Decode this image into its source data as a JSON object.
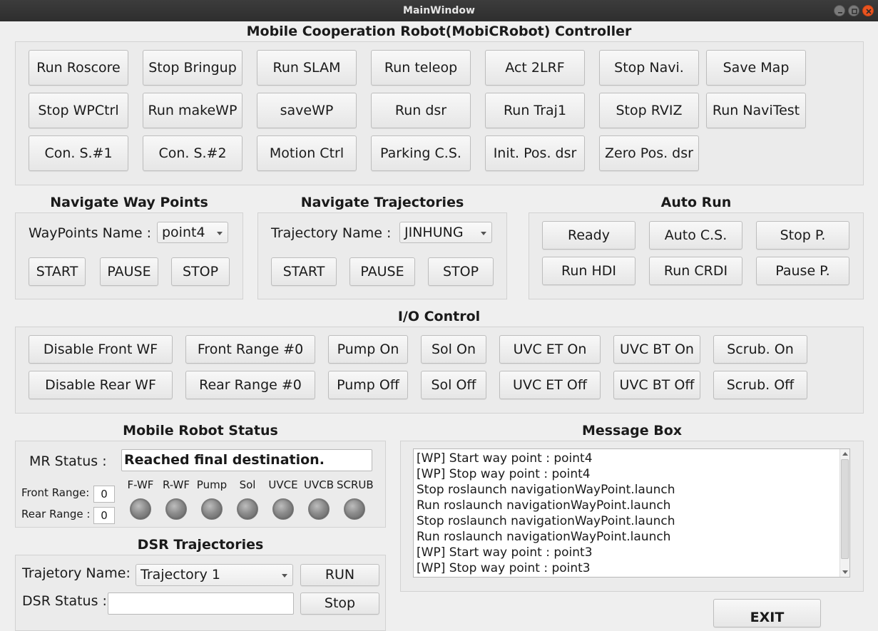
{
  "window": {
    "title": "MainWindow"
  },
  "controller": {
    "title": "Mobile Cooperation Robot(MobiCRobot) Controller",
    "buttons": [
      "Run Roscore",
      "Stop Bringup",
      "Run SLAM",
      "Run teleop",
      "Act 2LRF",
      "Stop Navi.",
      "Save Map",
      "Stop WPCtrl",
      "Run makeWP",
      "saveWP",
      "Run dsr",
      "Run Traj1",
      "Stop RVIZ",
      "Run NaviTest",
      "Con. S.#1",
      "Con. S.#2",
      "Motion Ctrl",
      "Parking C.S.",
      "Init. Pos. dsr",
      "Zero Pos. dsr"
    ]
  },
  "waypoints": {
    "title": "Navigate Way Points",
    "name_label": "WayPoints Name :",
    "selected": "point4",
    "start": "START",
    "pause": "PAUSE",
    "stop": "STOP"
  },
  "trajectories": {
    "title": "Navigate Trajectories",
    "name_label": "Trajectory Name :",
    "selected": "JINHUNG",
    "start": "START",
    "pause": "PAUSE",
    "stop": "STOP"
  },
  "autorun": {
    "title": "Auto Run",
    "buttons": [
      "Ready",
      "Auto C.S.",
      "Stop P.",
      "Run HDI",
      "Run CRDI",
      "Pause P."
    ]
  },
  "io": {
    "title": "I/O Control",
    "buttons": [
      "Disable Front WF",
      "Front Range #0",
      "Pump On",
      "Sol On",
      "UVC ET On",
      "UVC BT On",
      "Scrub. On",
      "Disable Rear WF",
      "Rear Range #0",
      "Pump Off",
      "Sol Off",
      "UVC ET Off",
      "UVC BT Off",
      "Scrub. Off"
    ]
  },
  "status": {
    "title": "Mobile Robot Status",
    "mr_label": "MR Status   :",
    "mr_value": "Reached final destination.",
    "front_label": "Front Range:",
    "front_value": "0",
    "rear_label": "Rear Range  :",
    "rear_value": "0",
    "indicators": [
      "F-WF",
      "R-WF",
      "Pump",
      "Sol",
      "UVCE",
      "UVCB",
      "SCRUB"
    ]
  },
  "messages": {
    "title": "Message Box",
    "lines": [
      "[WP] Start way point : point4",
      "[WP] Stop way point : point4",
      "Stop roslaunch navigationWayPoint.launch",
      "Run roslaunch navigationWayPoint.launch",
      "Stop roslaunch navigationWayPoint.launch",
      "Run roslaunch navigationWayPoint.launch",
      "[WP] Start way point : point3",
      "[WP] Stop way point : point3"
    ]
  },
  "dsr": {
    "title": "DSR Trajectories",
    "name_label": "Trajetory Name:",
    "selected": "Trajectory 1",
    "run": "RUN",
    "status_label": "DSR Status :",
    "status_value": "",
    "stop": "Stop"
  },
  "exit_label": "EXIT"
}
